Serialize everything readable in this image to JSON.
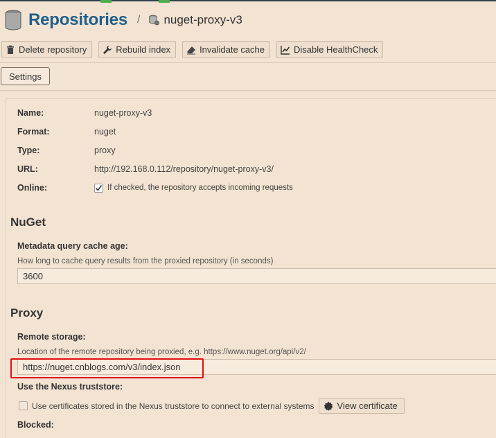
{
  "header": {
    "title": "Repositories",
    "separator": "/",
    "subtitle": "nuget-proxy-v3"
  },
  "toolbar": {
    "delete_label": "Delete repository",
    "rebuild_label": "Rebuild index",
    "invalidate_label": "Invalidate cache",
    "disable_label": "Disable HealthCheck"
  },
  "tabs": {
    "settings_label": "Settings"
  },
  "info": {
    "name_label": "Name:",
    "name_value": "nuget-proxy-v3",
    "format_label": "Format:",
    "format_value": "nuget",
    "type_label": "Type:",
    "type_value": "proxy",
    "url_label": "URL:",
    "url_value": "http://192.168.0.112/repository/nuget-proxy-v3/",
    "online_label": "Online:",
    "online_checked": true,
    "online_help": "If checked, the repository accepts incoming requests"
  },
  "nuget": {
    "heading": "NuGet",
    "cache_label": "Metadata query cache age:",
    "cache_help": "How long to cache query results from the proxied repository (in seconds)",
    "cache_value": "3600"
  },
  "proxy": {
    "heading": "Proxy",
    "remote_label": "Remote storage:",
    "remote_help": "Location of the remote repository being proxied, e.g. https://www.nuget.org/api/v2/",
    "remote_value": "https://nuget.cnblogs.com/v3/index.json",
    "truststore_label": "Use the Nexus truststore:",
    "truststore_checked": false,
    "truststore_help": "Use certificates stored in the Nexus truststore to connect to external systems",
    "view_certificate_label": "View certificate",
    "blocked_label": "Blocked:"
  },
  "colors": {
    "background": "#f3e3d2",
    "title_blue": "#1f5f8b",
    "highlight_red": "#e01010",
    "accent_green": "#4cae4c"
  }
}
